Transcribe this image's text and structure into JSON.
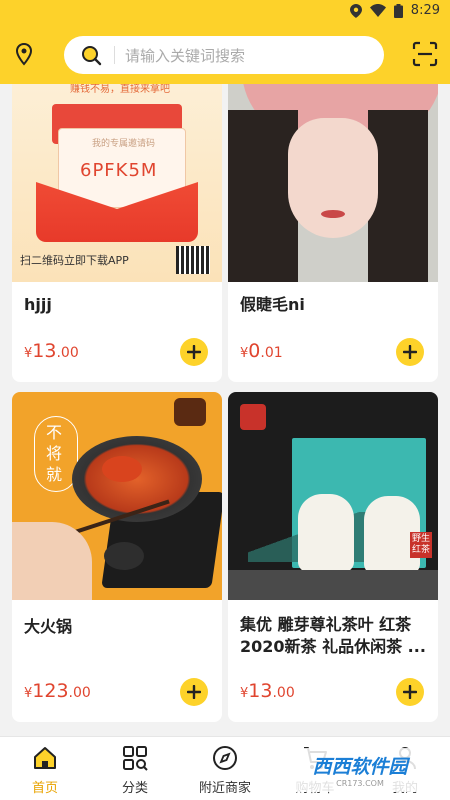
{
  "status_bar": {
    "time": "8:29"
  },
  "header": {
    "search_placeholder": "请输入关键词搜索"
  },
  "products": [
    {
      "name": "hjjj",
      "currency": "¥",
      "price_int": "13",
      "price_dec": ".00",
      "image": {
        "top_text": "赚钱不易，直接来拿吧",
        "code": "6PFK5M",
        "code_caption": "我的专属邀请码",
        "bottom_text": "扫二维码立即下载APP"
      }
    },
    {
      "name": "假睫毛ni",
      "currency": "¥",
      "price_int": "0",
      "price_dec": ".01",
      "image": {}
    },
    {
      "name": "大火锅",
      "currency": "¥",
      "price_int": "123",
      "price_dec": ".00",
      "image": {
        "slogan": "不将就"
      }
    },
    {
      "name": "集优 雕芽尊礼茶叶 红茶2020新茶 礼品休闲茶 ...",
      "currency": "¥",
      "price_int": "13",
      "price_dec": ".00",
      "image": {
        "side_text": "野生红茶"
      }
    }
  ],
  "tabs": [
    {
      "label": "首页",
      "icon": "home-icon",
      "active": true
    },
    {
      "label": "分类",
      "icon": "category-icon",
      "active": false
    },
    {
      "label": "附近商家",
      "icon": "compass-icon",
      "active": false
    },
    {
      "label": "购物车",
      "icon": "cart-icon",
      "active": false
    },
    {
      "label": "我的",
      "icon": "user-icon",
      "active": false
    }
  ],
  "watermark": {
    "text": "西西软件园",
    "sub": "CR173.COM"
  },
  "colors": {
    "accent": "#fdd22a",
    "price": "#e0452f",
    "active_tab": "#e8a300"
  }
}
